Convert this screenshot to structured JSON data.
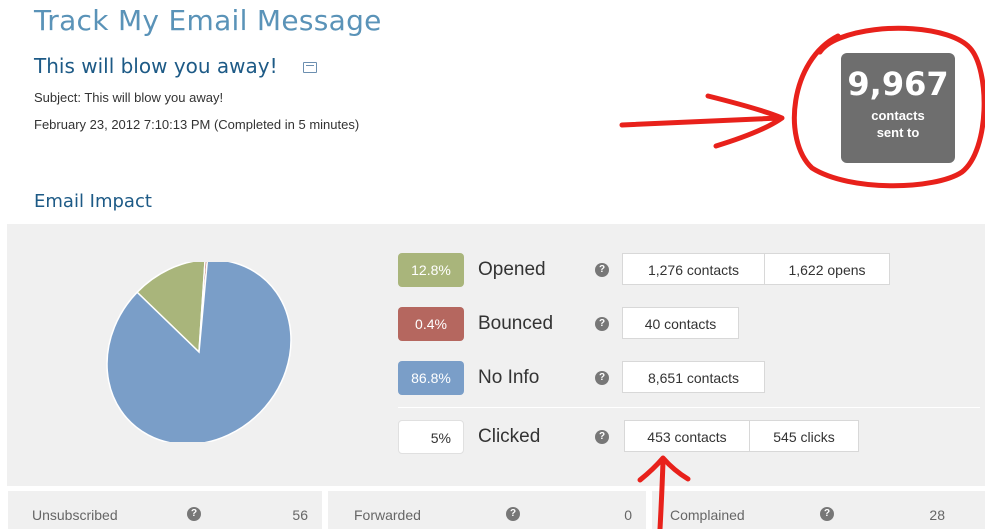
{
  "header": {
    "page_title": "Track My Email Message",
    "message_title": "This will blow you away!",
    "subject": "Subject: This will blow you away!",
    "sent_date": "February 23, 2012 7:10:13 PM (Completed in 5 minutes)"
  },
  "sent_summary": {
    "count": "9,967",
    "label_line1": "contacts",
    "label_line2": "sent to"
  },
  "impact": {
    "heading": "Email Impact",
    "pie_slices": [
      {
        "name": "Opened",
        "fraction": 0.128,
        "color": "#a9b57b"
      },
      {
        "name": "Bounced",
        "fraction": 0.004,
        "color": "#b5675f"
      },
      {
        "name": "No Info",
        "fraction": 0.868,
        "color": "#7a9ec8"
      }
    ],
    "rows": [
      {
        "pct": "12.8%",
        "label": "Opened",
        "color": "#a9b57b",
        "pill1": "1,276 contacts",
        "pill2": "1,622 opens"
      },
      {
        "pct": "0.4%",
        "label": "Bounced",
        "color": "#b5675f",
        "pill1": "40 contacts"
      },
      {
        "pct": "86.8%",
        "label": "No Info",
        "color": "#7a9ec8",
        "pill1": "8,651 contacts"
      },
      {
        "pct": "5%",
        "label": "Clicked",
        "color": "#ffffff",
        "pill1": "453 contacts",
        "pill2": "545 clicks"
      }
    ],
    "help_glyph": "?"
  },
  "bottom_stats": [
    {
      "label": "Unsubscribed",
      "count": "56"
    },
    {
      "label": "Forwarded",
      "count": "0"
    },
    {
      "label": "Complained",
      "count": "28"
    }
  ],
  "colors": {
    "annotation": "#e8211b",
    "accent": "#1d5a86",
    "sent_box": "#6e6e6e"
  }
}
